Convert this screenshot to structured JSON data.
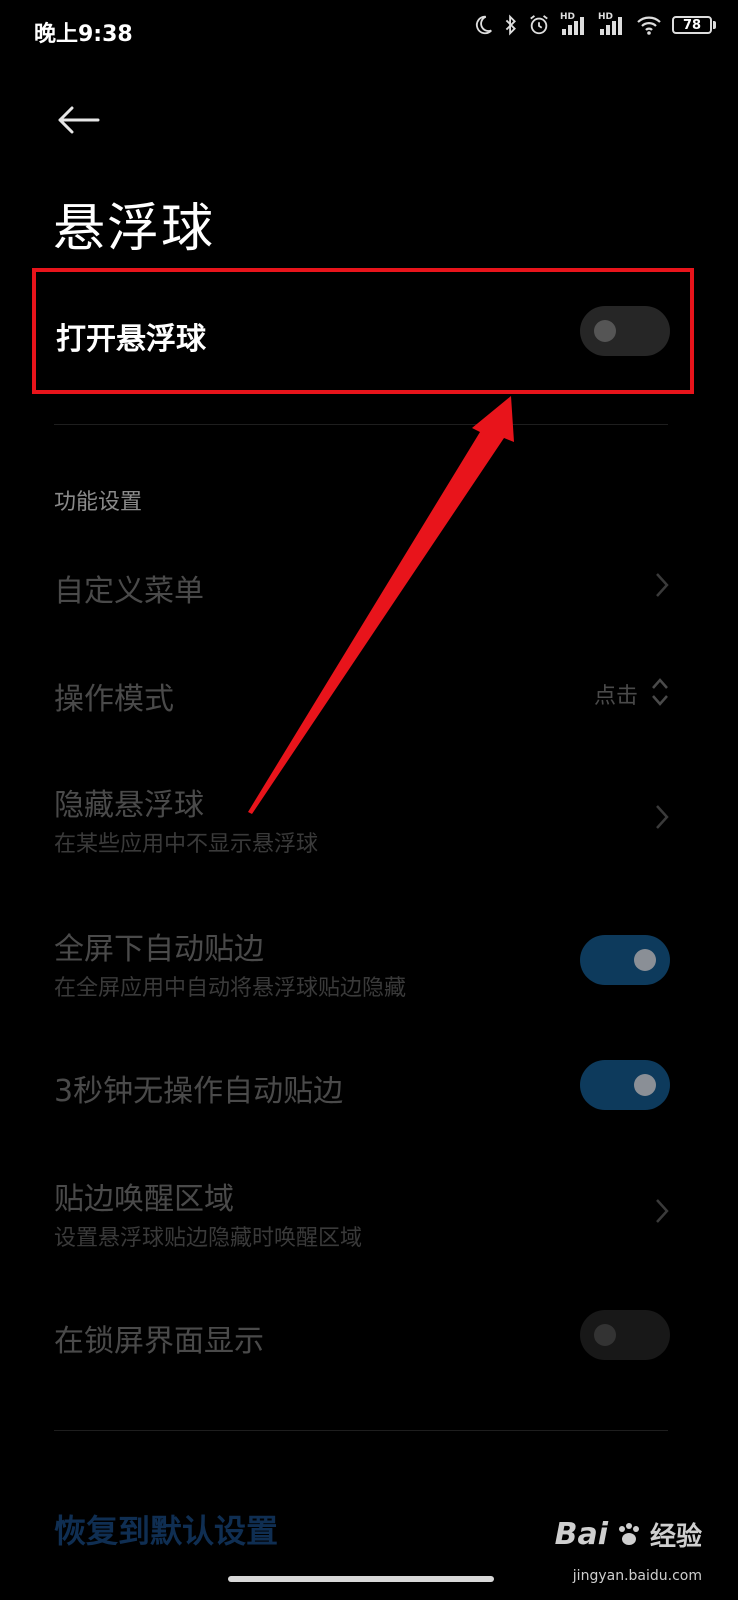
{
  "status_bar": {
    "time": "晚上9:38",
    "battery": "78",
    "hd_label_1": "HD",
    "hd_label_2": "HD"
  },
  "header": {
    "title": "悬浮球"
  },
  "enable_row": {
    "label": "打开悬浮球",
    "enabled": false
  },
  "section": {
    "header": "功能设置"
  },
  "settings": {
    "custom_menu": {
      "label": "自定义菜单"
    },
    "operation_mode": {
      "label": "操作模式",
      "value": "点击"
    },
    "hide_ball": {
      "label": "隐藏悬浮球",
      "sub": "在某些应用中不显示悬浮球"
    },
    "fullscreen_edge": {
      "label": "全屏下自动贴边",
      "sub": "在全屏应用中自动将悬浮球贴边隐藏",
      "enabled": true
    },
    "idle_edge": {
      "label": "3秒钟无操作自动贴边",
      "enabled": true
    },
    "wake_area": {
      "label": "贴边唤醒区域",
      "sub": "设置悬浮球贴边隐藏时唤醒区域"
    },
    "lockscreen": {
      "label": "在锁屏界面显示",
      "enabled": false
    }
  },
  "footer": {
    "reset_label": "恢复到默认设置"
  },
  "watermark": {
    "brand": "Bai",
    "text": "经验",
    "url": "jingyan.baidu.com"
  },
  "colors": {
    "annotation": "#e8141b",
    "toggle_on": "#0d3a5c",
    "reset_link": "#0f2e52"
  }
}
